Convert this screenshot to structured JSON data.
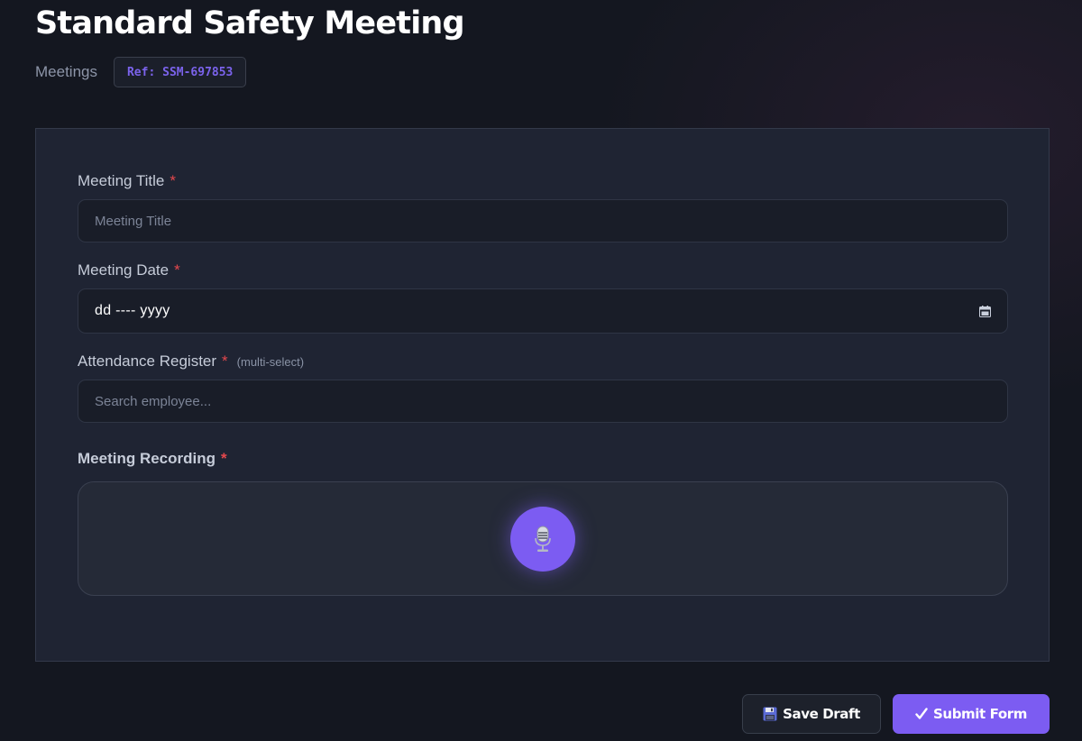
{
  "header": {
    "title": "Standard Safety Meeting",
    "breadcrumb": "Meetings",
    "ref_badge": "Ref: SSM-697853"
  },
  "form": {
    "meeting_title": {
      "label": "Meeting Title",
      "required_mark": "*",
      "placeholder": "Meeting Title"
    },
    "meeting_date": {
      "label": "Meeting Date",
      "required_mark": "*",
      "value": "dd ---- yyyy",
      "icon": "calendar-icon"
    },
    "attendance": {
      "label": "Attendance Register",
      "required_mark": "*",
      "hint": "(multi-select)",
      "placeholder": "Search employee..."
    },
    "recording": {
      "label": "Meeting Recording",
      "required_mark": "*",
      "icon": "microphone-icon"
    }
  },
  "actions": {
    "save_draft_label": "Save Draft",
    "save_draft_icon": "floppy-disk-icon",
    "submit_label": "Submit Form",
    "submit_icon": "checkmark-icon"
  },
  "colors": {
    "accent": "#7c5cf2",
    "required": "#e5484d",
    "background": "#141720",
    "card": "#1f2433"
  }
}
